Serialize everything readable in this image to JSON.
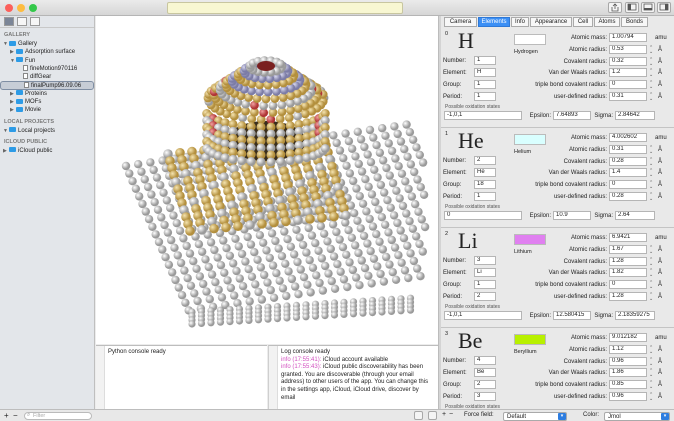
{
  "window": {
    "title": ""
  },
  "sidebar": {
    "gallery_header": "GALLERY",
    "gallery_items": [
      {
        "label": "Gallery",
        "level": 0,
        "type": "folder",
        "open": true
      },
      {
        "label": "Adsorption surface",
        "level": 1,
        "type": "folder",
        "open": false
      },
      {
        "label": "Fun",
        "level": 1,
        "type": "folder",
        "open": true
      },
      {
        "label": "fineMotion970116",
        "level": 2,
        "type": "doc"
      },
      {
        "label": "diffGear",
        "level": 2,
        "type": "doc"
      },
      {
        "label": "finalPump96.09.06",
        "level": 2,
        "type": "doc",
        "selected": true
      },
      {
        "label": "Proteins",
        "level": 1,
        "type": "folder",
        "open": false
      },
      {
        "label": "MOFs",
        "level": 1,
        "type": "folder",
        "open": false
      },
      {
        "label": "Movie",
        "level": 1,
        "type": "folder",
        "open": false
      }
    ],
    "local_header": "LOCAL PROJECTS",
    "local_items": [
      {
        "label": "Local projects",
        "level": 0,
        "type": "folder",
        "open": true
      }
    ],
    "icloud_header": "ICLOUD PUBLIC",
    "icloud_items": [
      {
        "label": "iCloud public",
        "level": 0,
        "type": "folder",
        "open": false
      }
    ]
  },
  "bottom": {
    "add": "+",
    "remove": "−",
    "filter_placeholder": "Filter",
    "force_field_label": "Force field:",
    "force_field_value": "Default",
    "color_label": "Color:",
    "color_value": "Jmol"
  },
  "console": {
    "python": "Python console ready",
    "log_ready": "Log console ready",
    "log_entries": [
      {
        "time": "info (17:55:41):",
        "text": "iCloud account available"
      },
      {
        "time": "info (17:55:43):",
        "text": "iCloud public discoverability has been granted. You are discoverable (through your email address) to other users of the app. You can change this in the settings app, iCloud, iCloud drive, discover by email"
      }
    ]
  },
  "inspector": {
    "tabs": [
      "Camera",
      "Elements",
      "Info",
      "Appearance",
      "Cell",
      "Atoms",
      "Bonds"
    ],
    "active_tab": "Elements",
    "labels": {
      "number": "Number:",
      "element": "Element:",
      "group": "Group:",
      "period": "Period:",
      "atomic_mass": "Atomic mass:",
      "atomic_radius": "Atomic radius:",
      "covalent_radius": "Covalent radius:",
      "vdw_radius": "Van der Waals radius:",
      "triple_bond": "triple bond covalent radius:",
      "user_radius": "user-defined radius:",
      "oxidation": "Possible oxidation states",
      "epsilon": "Epsilon:",
      "sigma": "Sigma:",
      "amu": "amu",
      "angstrom": "Å"
    },
    "elements": [
      {
        "index": "0",
        "symbol": "H",
        "name": "Hydrogen",
        "color": "#ffffff",
        "number": "1",
        "element": "H",
        "group": "1",
        "period": "1",
        "atomic_mass": "1.00794",
        "atomic_radius": "0.53",
        "covalent_radius": "0.32",
        "vdw_radius": "1.2",
        "triple_bond": "0",
        "user_radius": "0.31",
        "oxidation": "-1,0,1",
        "epsilon": "7.64893",
        "sigma": "2.84642"
      },
      {
        "index": "1",
        "symbol": "He",
        "name": "Helium",
        "color": "#d9ffff",
        "number": "2",
        "element": "He",
        "group": "18",
        "period": "1",
        "atomic_mass": "4.002602",
        "atomic_radius": "0.31",
        "covalent_radius": "0.28",
        "vdw_radius": "1.4",
        "triple_bond": "0",
        "user_radius": "0.28",
        "oxidation": "0",
        "epsilon": "10.9",
        "sigma": "2.64"
      },
      {
        "index": "2",
        "symbol": "Li",
        "name": "Lithium",
        "color": "#e080f0",
        "number": "3",
        "element": "Li",
        "group": "1",
        "period": "2",
        "atomic_mass": "6.9421",
        "atomic_radius": "1.67",
        "covalent_radius": "1.28",
        "vdw_radius": "1.82",
        "triple_bond": "0",
        "user_radius": "1.28",
        "oxidation": "-1,0,1",
        "epsilon": "12.580415",
        "sigma": "2.18359275"
      },
      {
        "index": "3",
        "symbol": "Be",
        "name": "Beryllium",
        "color": "#b8f000",
        "number": "4",
        "element": "Be",
        "group": "2",
        "period": "3",
        "atomic_mass": "9.012182",
        "atomic_radius": "1.12",
        "covalent_radius": "0.96",
        "vdw_radius": "1.86",
        "triple_bond": "0.85",
        "user_radius": "0.96",
        "oxidation": "",
        "epsilon": "",
        "sigma": ""
      }
    ]
  }
}
